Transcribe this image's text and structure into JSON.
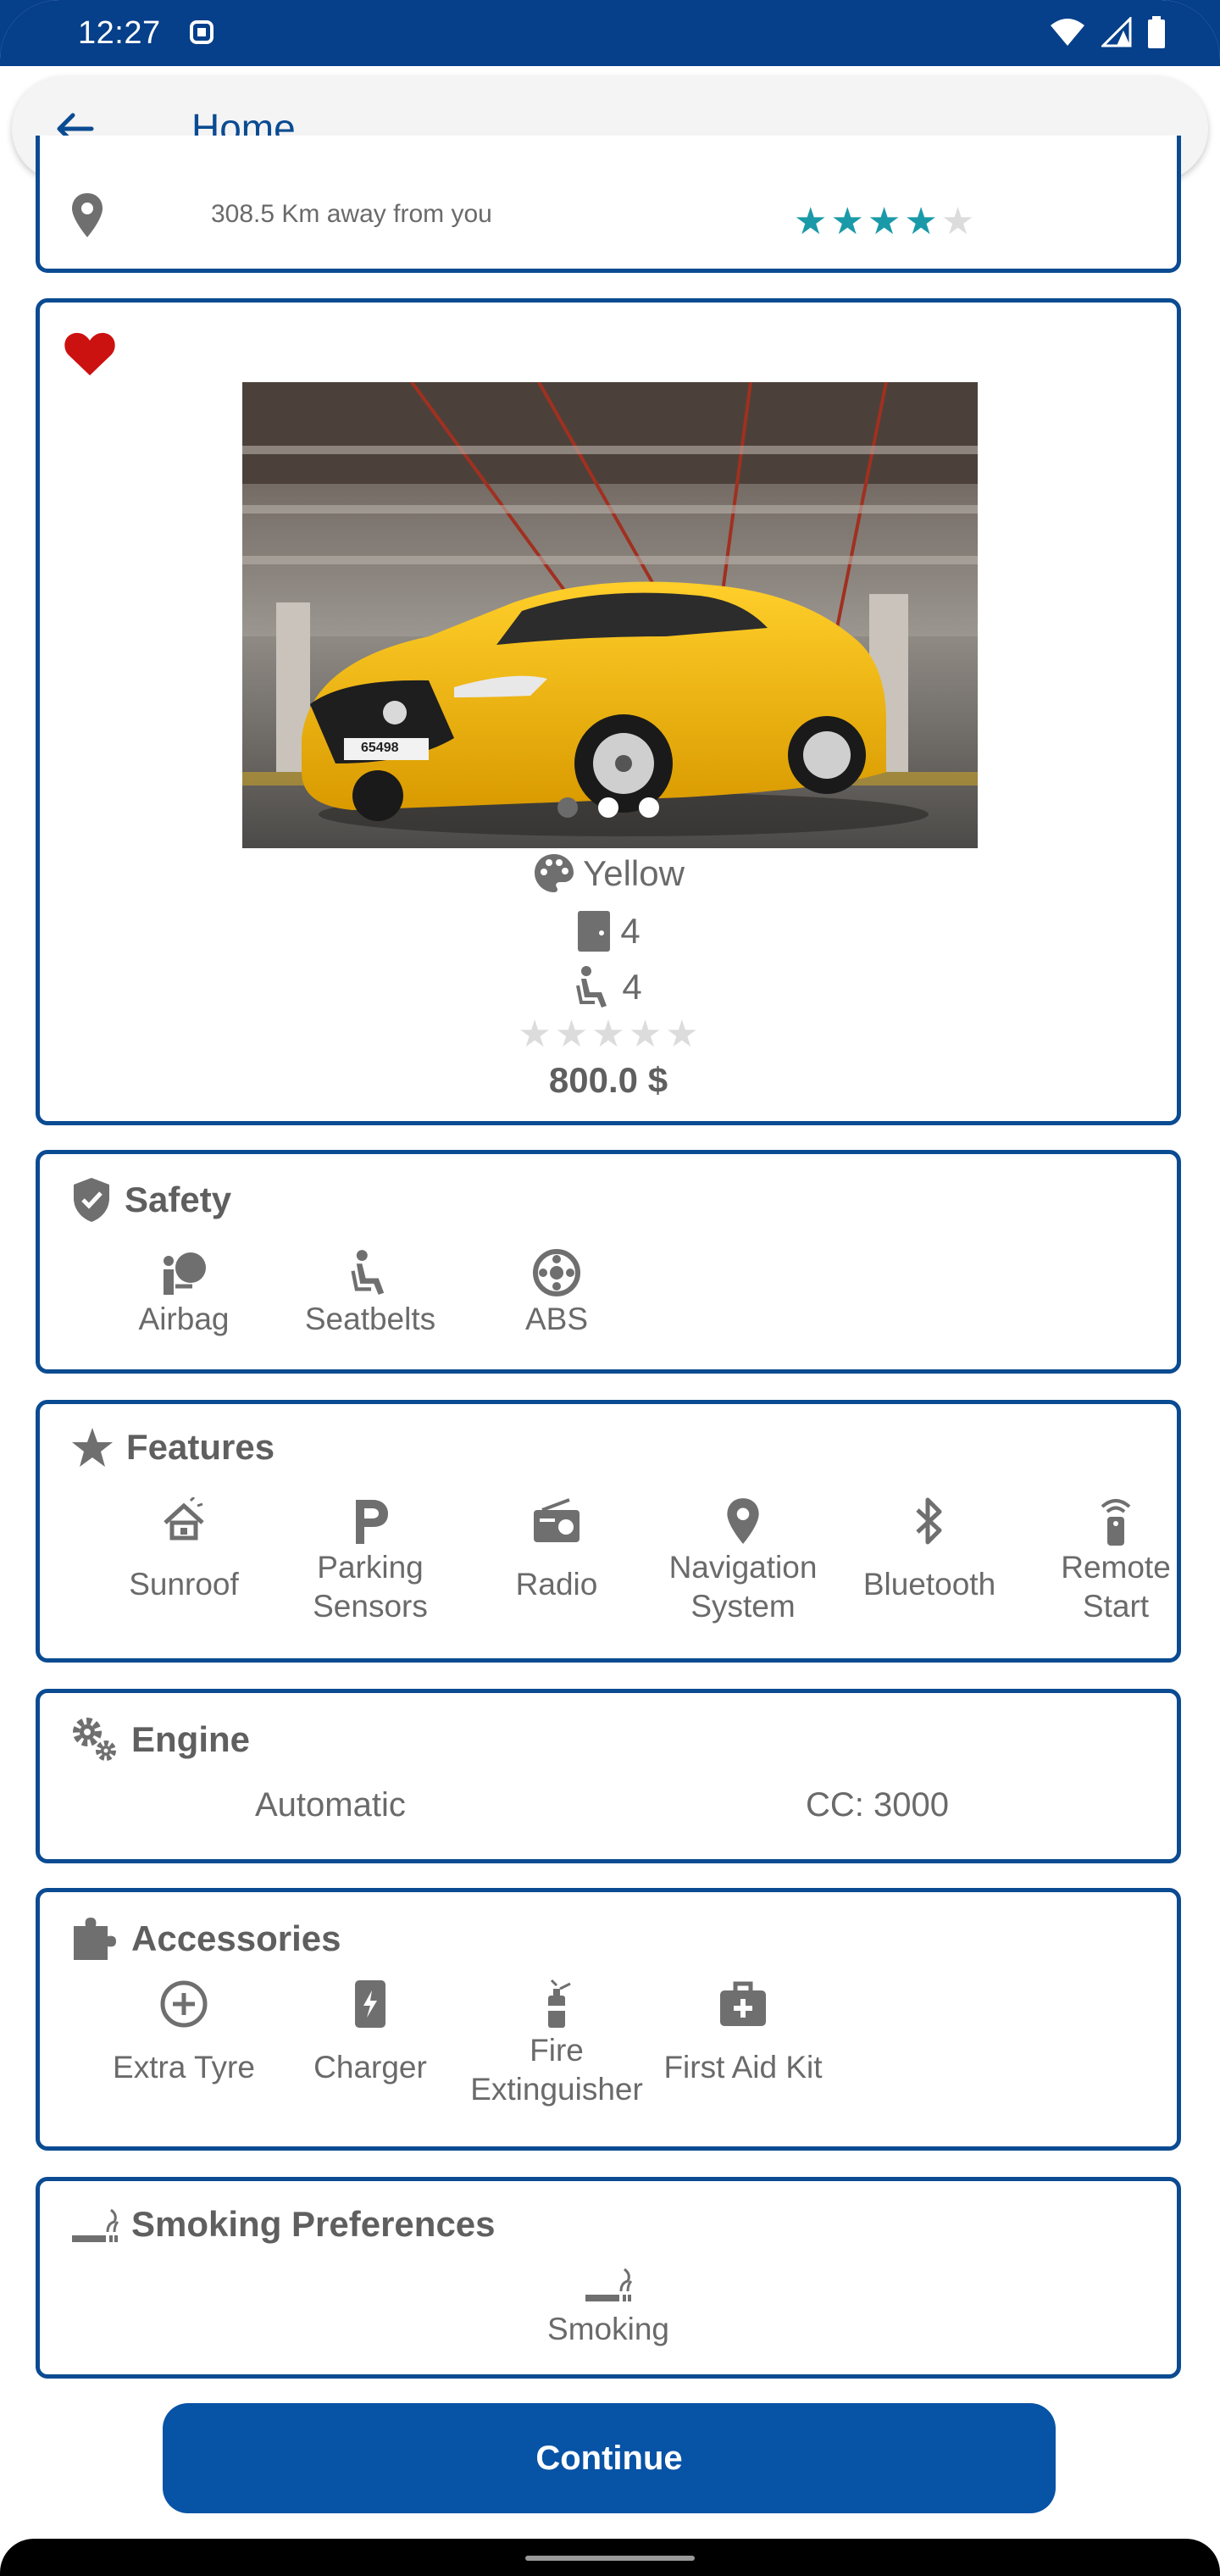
{
  "status_bar": {
    "time": "12:27"
  },
  "app_bar": {
    "title": "Home"
  },
  "listing_top": {
    "distance": "308.5 Km away from you",
    "rating": 4
  },
  "car": {
    "color": "Yellow",
    "doors": "4",
    "seats": "4",
    "rating": 0,
    "price": "800.0 $",
    "image_count": 3,
    "image_active_index": 0,
    "plate_text": "65498"
  },
  "safety": {
    "title": "Safety",
    "items": [
      {
        "label": "Airbag",
        "icon": "airbag-icon"
      },
      {
        "label": "Seatbelts",
        "icon": "seatbelt-icon"
      },
      {
        "label": "ABS",
        "icon": "abs-icon"
      }
    ]
  },
  "features": {
    "title": "Features",
    "items": [
      {
        "label": "Sunroof",
        "icon": "sunroof-icon"
      },
      {
        "label": "Parking\nSensors",
        "icon": "parking-icon"
      },
      {
        "label": "Radio",
        "icon": "radio-icon"
      },
      {
        "label": "Navigation\nSystem",
        "icon": "location-pin-icon"
      },
      {
        "label": "Bluetooth",
        "icon": "bluetooth-icon"
      },
      {
        "label": "Remote\nStart",
        "icon": "remote-icon"
      }
    ]
  },
  "engine": {
    "title": "Engine",
    "transmission": "Automatic",
    "cc": "CC: 3000"
  },
  "accessories": {
    "title": "Accessories",
    "items": [
      {
        "label": "Extra Tyre",
        "icon": "plus-circle-icon"
      },
      {
        "label": "Charger",
        "icon": "charger-icon"
      },
      {
        "label": "Fire\nExtinguisher",
        "icon": "fire-extinguisher-icon"
      },
      {
        "label": "First Aid Kit",
        "icon": "first-aid-icon"
      }
    ]
  },
  "smoking": {
    "title": "Smoking Preferences",
    "value": "Smoking"
  },
  "continue_label": "Continue",
  "colors": {
    "primary": "#0a4b92",
    "button": "#0753a6",
    "rating_star": "#1a9aa8",
    "favorite": "#cc1111"
  }
}
